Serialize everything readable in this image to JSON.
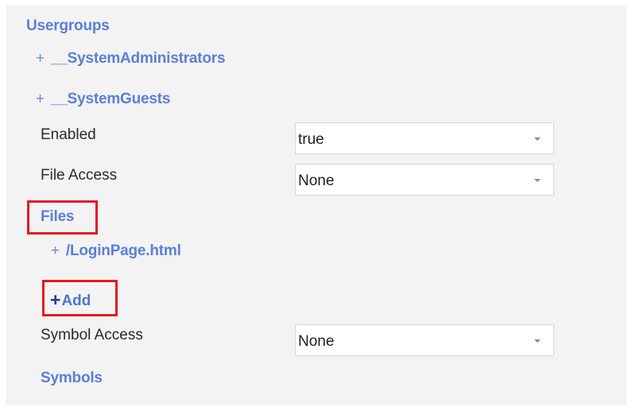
{
  "usergroups": {
    "title": "Usergroups",
    "items": [
      {
        "toggle": "+",
        "label": "__SystemAdministrators"
      },
      {
        "toggle": "+",
        "label": "__SystemGuests"
      }
    ]
  },
  "fields": {
    "enabled": {
      "label": "Enabled",
      "value": "true"
    },
    "file_access": {
      "label": "File Access",
      "value": "None"
    },
    "symbol_access": {
      "label": "Symbol Access",
      "value": "None"
    }
  },
  "files": {
    "title": "Files",
    "items": [
      {
        "toggle": "+",
        "label": "/LoginPage.html"
      }
    ],
    "add": {
      "plus": "+",
      "label": "Add"
    }
  },
  "symbols": {
    "title": "Symbols"
  },
  "colors": {
    "link": "#5b7fd6",
    "highlight": "#e11b23",
    "panel_bg": "#f3f3f3"
  },
  "icons": {
    "dropdown": "caret-down-icon",
    "expand": "plus-icon"
  }
}
